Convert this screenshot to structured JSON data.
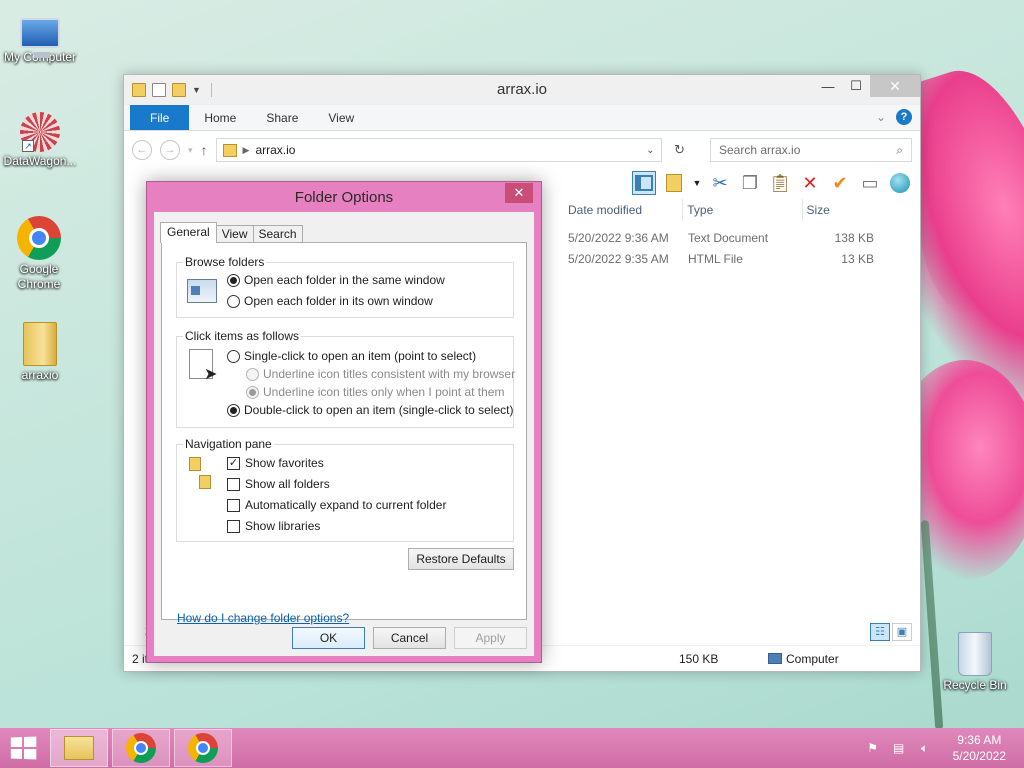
{
  "desktop": {
    "icons": [
      {
        "label": "My Computer"
      },
      {
        "label": "DataWagon..."
      },
      {
        "label": "Google Chrome"
      },
      {
        "label": "arraxio"
      },
      {
        "label": "Recycle Bin"
      }
    ]
  },
  "explorer": {
    "title": "arrax.io",
    "ribbon_tabs": [
      "File",
      "Home",
      "Share",
      "View"
    ],
    "address": "arrax.io",
    "search_placeholder": "Search arrax.io",
    "columns": [
      "Date modified",
      "Type",
      "Size"
    ],
    "files": [
      {
        "date": "5/20/2022 9:36 AM",
        "type": "Text Document",
        "size": "138 KB"
      },
      {
        "date": "5/20/2022 9:35 AM",
        "type": "HTML File",
        "size": "13 KB"
      }
    ],
    "status": {
      "count": "2 it",
      "size": "150 KB",
      "location": "Computer"
    },
    "side_text": "2"
  },
  "dialog": {
    "title": "Folder Options",
    "tabs": [
      "General",
      "View",
      "Search"
    ],
    "browse": {
      "label": "Browse folders",
      "same_window": "Open each folder in the same window",
      "own_window": "Open each folder in its own window"
    },
    "click": {
      "label": "Click items as follows",
      "single": "Single-click to open an item (point to select)",
      "underline_consistent": "Underline icon titles consistent with my browser",
      "underline_point": "Underline icon titles only when I point at them",
      "double": "Double-click to open an item (single-click to select)"
    },
    "nav": {
      "label": "Navigation pane",
      "favorites": "Show favorites",
      "all_folders": "Show all folders",
      "expand": "Automatically expand to current folder",
      "libraries": "Show libraries"
    },
    "restore_defaults": "Restore Defaults",
    "help_link": "How do I change folder options?",
    "ok": "OK",
    "cancel": "Cancel",
    "apply": "Apply"
  },
  "taskbar": {
    "time": "9:36 AM",
    "date": "5/20/2022"
  }
}
